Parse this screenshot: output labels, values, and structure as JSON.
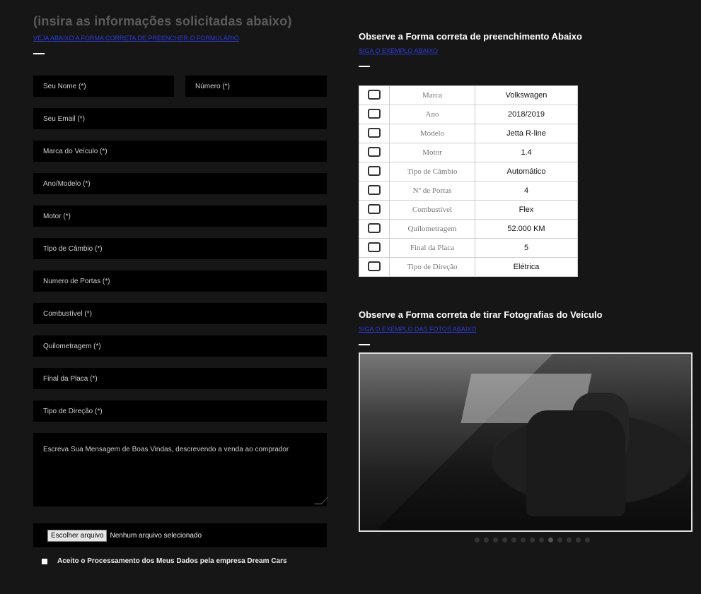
{
  "left": {
    "hint_title": "(insira as informações solicitadas abaixo)",
    "blue_link": "VEJA ABAIXO A FORMA CORRETA DE PREENCHER O FORMULÁRIO"
  },
  "form": {
    "name": "Seu Nome (*)",
    "number": "Número (*)",
    "email": "Seu Email (*)",
    "brand": "Marca do Veículo (*)",
    "year_model": "Ano/Modelo (*)",
    "engine": "Motor (*)",
    "transmission": "Tipo de Câmbio (*)",
    "doors": "Numero de Portas (*)",
    "fuel": "Combustível (*)",
    "mileage": "Quilometragem (*)",
    "plate_end": "Final da Placa (*)",
    "steering": "Tipo de Direção (*)",
    "message": "Escreva Sua Mensagem de Boas Vindas, descrevendo a venda ao comprador",
    "file_button": "Escolher arquivo",
    "file_status": "Nenhum arquivo selecionado",
    "consent": "Aceito o Processamento dos Meus Dados pela empresa Dream Cars"
  },
  "right": {
    "fill_title": "Observe a Forma correta de preenchimento Abaixo",
    "fill_link": "SIGA O EXEMPLO ABAIXO",
    "photo_title": "Observe a Forma correta de tirar Fotografias do Veículo",
    "photo_link": "SIGA O EXEMPLO DAS FOTOS ABAIXO"
  },
  "spec_table": [
    {
      "icon": "shield-icon",
      "label": "Marca",
      "value": "Volkswagen"
    },
    {
      "icon": "calendar-icon",
      "label": "Ano",
      "value": "2018/2019"
    },
    {
      "icon": "car-icon",
      "label": "Modelo",
      "value": "Jetta R-line"
    },
    {
      "icon": "engine-icon",
      "label": "Motor",
      "value": "1.4"
    },
    {
      "icon": "gearbox-icon",
      "label": "Tipo de Câmbio",
      "value": "Automático"
    },
    {
      "icon": "door-icon",
      "label": "Nº de Portas",
      "value": "4"
    },
    {
      "icon": "fuel-pump-icon",
      "label": "Combustível",
      "value": "Flex"
    },
    {
      "icon": "speedometer-icon",
      "label": "Quilometragem",
      "value": "52.000 KM"
    },
    {
      "icon": "license-plate-icon",
      "label": "Final da Placa",
      "value": "5"
    },
    {
      "icon": "steering-wheel-icon",
      "label": "Tipo de Direção",
      "value": "Elétrica"
    }
  ],
  "carousel": {
    "count": 13,
    "active_index": 8
  }
}
